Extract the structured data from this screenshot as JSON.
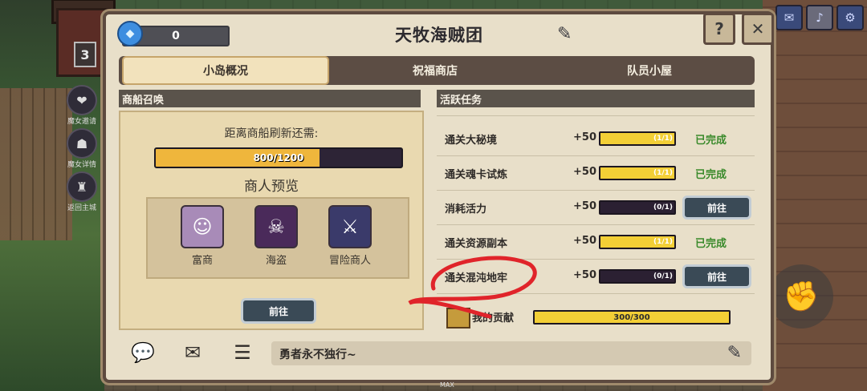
{
  "hud": {
    "level": "3",
    "side_buttons": [
      "魔女邀请",
      "魔女详情",
      "返回主城"
    ],
    "max_label": "MAX"
  },
  "header": {
    "gems": "0",
    "title": "天牧海贼团",
    "help_symbol": "?",
    "close_symbol": "✕"
  },
  "tabs": [
    {
      "label": "小岛概况",
      "active": true
    },
    {
      "label": "祝福商店",
      "active": false
    },
    {
      "label": "队员小屋",
      "active": false
    }
  ],
  "left": {
    "section_title": "商船召唤",
    "timer_label": "距离商船刷新还需:",
    "progress": {
      "current": 800,
      "max": 1200,
      "text": "800/1200"
    },
    "preview_title": "商人预览",
    "merchants": [
      {
        "name": "富商",
        "icon": "rich-merchant-icon"
      },
      {
        "name": "海盗",
        "icon": "pirate-icon"
      },
      {
        "name": "冒险商人",
        "icon": "adventurer-merchant-icon"
      }
    ],
    "go_label": "前往"
  },
  "right": {
    "section_title": "活跃任务",
    "tasks": [
      {
        "name": "通关大秘境",
        "points": "+50",
        "progress": 1,
        "text": "(1/1)",
        "status": "已完成"
      },
      {
        "name": "通关魂卡试炼",
        "points": "+50",
        "progress": 1,
        "text": "(1/1)",
        "status": "已完成"
      },
      {
        "name": "消耗活力",
        "points": "+50",
        "progress": 0,
        "text": "(0/1)",
        "status": "前往"
      },
      {
        "name": "通关资源副本",
        "points": "+50",
        "progress": 1,
        "text": "(1/1)",
        "status": "已完成"
      },
      {
        "name": "通关混沌地牢",
        "points": "+50",
        "progress": 0,
        "text": "(0/1)",
        "status": "前往"
      }
    ],
    "contribution": {
      "label": "我的贡献",
      "current": 300,
      "max": 300,
      "text": "300/300"
    }
  },
  "chat": {
    "placeholder": "勇者永不独行~"
  },
  "colors": {
    "accent": "#efb63c",
    "done": "#3a8a2b",
    "panel": "#e8dfc9",
    "annotation": "#e0242a"
  }
}
